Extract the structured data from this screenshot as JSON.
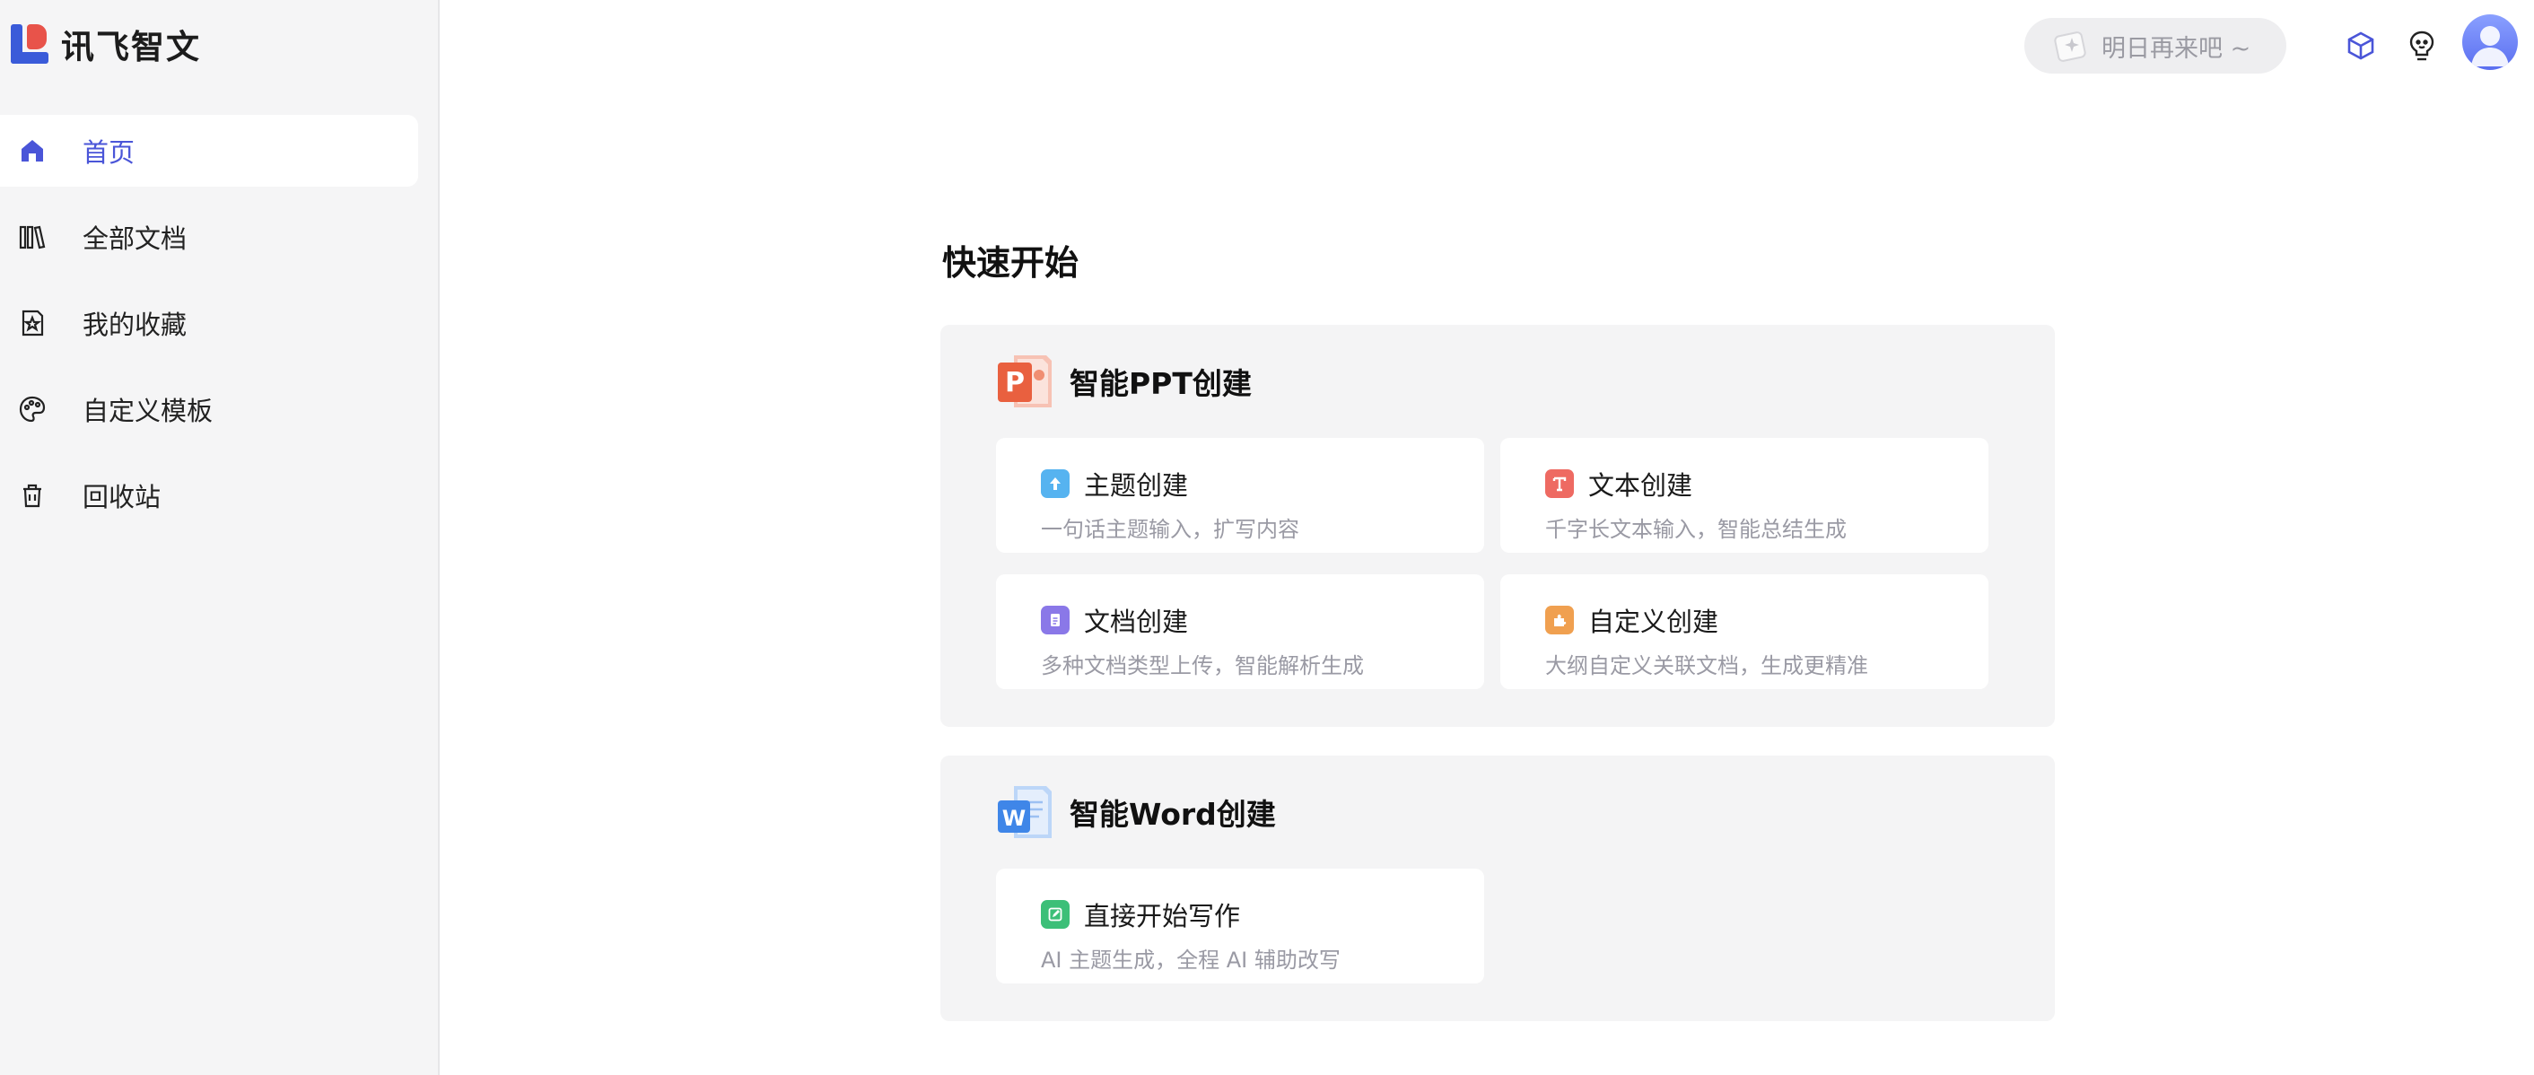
{
  "app": {
    "name": "讯飞智文"
  },
  "sidebar": {
    "items": [
      {
        "label": "首页",
        "icon": "home-icon",
        "active": true
      },
      {
        "label": "全部文档",
        "icon": "documents-icon",
        "active": false
      },
      {
        "label": "我的收藏",
        "icon": "favorite-icon",
        "active": false
      },
      {
        "label": "自定义模板",
        "icon": "palette-icon",
        "active": false
      },
      {
        "label": "回收站",
        "icon": "trash-icon",
        "active": false
      }
    ]
  },
  "header": {
    "checkin_label": "明日再来吧 ~",
    "accent_color": "#4a55d8"
  },
  "main": {
    "title": "快速开始",
    "ppt": {
      "title": "智能PPT创建",
      "cards": [
        {
          "title": "主题创建",
          "desc": "一句话主题输入，扩写内容",
          "icon": "topic-icon",
          "color": "#56b3f0"
        },
        {
          "title": "文本创建",
          "desc": "千字长文本输入，智能总结生成",
          "icon": "text-icon",
          "color": "#ee6a62"
        },
        {
          "title": "文档创建",
          "desc": "多种文档类型上传，智能解析生成",
          "icon": "document-icon",
          "color": "#8a78e8"
        },
        {
          "title": "自定义创建",
          "desc": "大纲自定义关联文档，生成更精准",
          "icon": "puzzle-icon",
          "color": "#f0a050"
        }
      ]
    },
    "word": {
      "title": "智能Word创建",
      "cards": [
        {
          "title": "直接开始写作",
          "desc": "AI 主题生成，全程 AI 辅助改写",
          "icon": "edit-icon",
          "color": "#3cbf78"
        }
      ]
    }
  }
}
